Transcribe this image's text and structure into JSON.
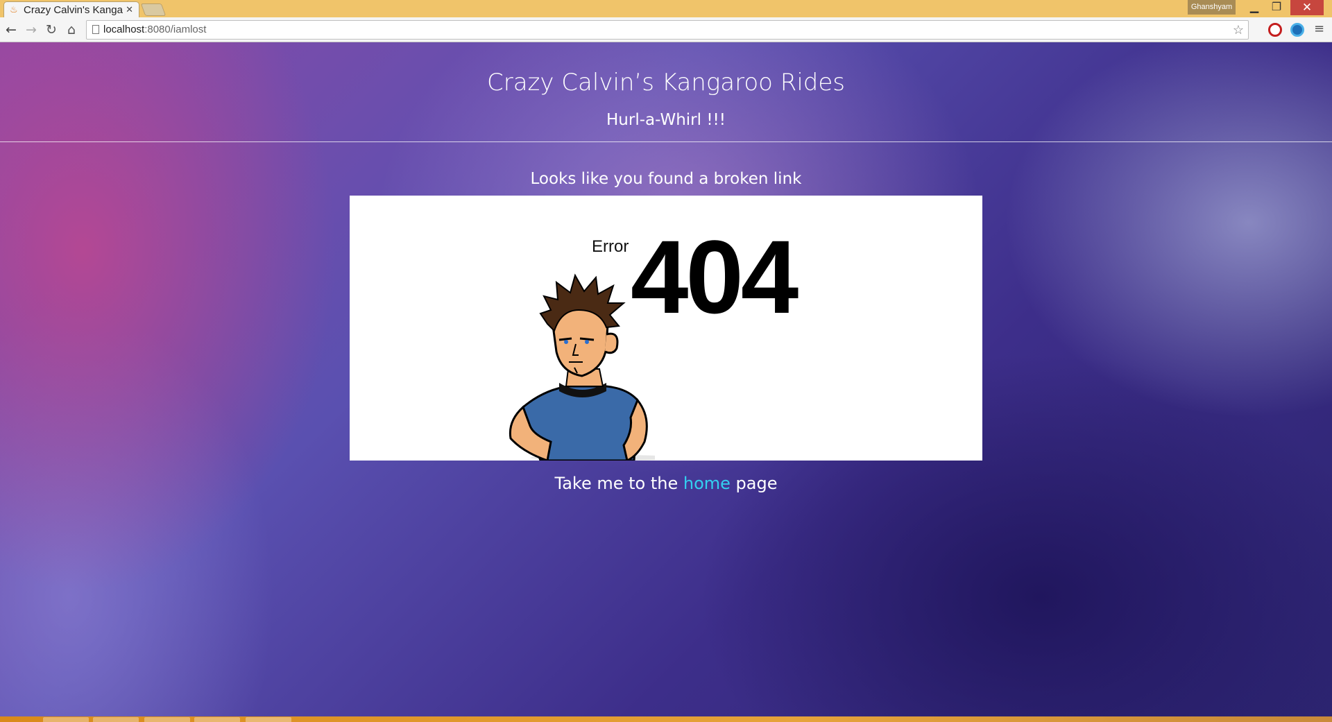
{
  "browser": {
    "tab_title": "Crazy Calvin's Kanga",
    "profile_name": "Ghanshyam",
    "url_host": "localhost",
    "url_path": ":8080/iamlost"
  },
  "page": {
    "site_title": "Crazy Calvin’s Kangaroo Rides",
    "subtitle": "Hurl-a-Whirl !!!",
    "message": "Looks like you found a broken link",
    "error_label": "Error",
    "error_code": "404",
    "footer_prefix": "Take me to the ",
    "footer_link": "home",
    "footer_suffix": " page"
  },
  "colors": {
    "link": "#33d0f0",
    "titlebar": "#f0c46a",
    "close_button": "#c7463e"
  }
}
